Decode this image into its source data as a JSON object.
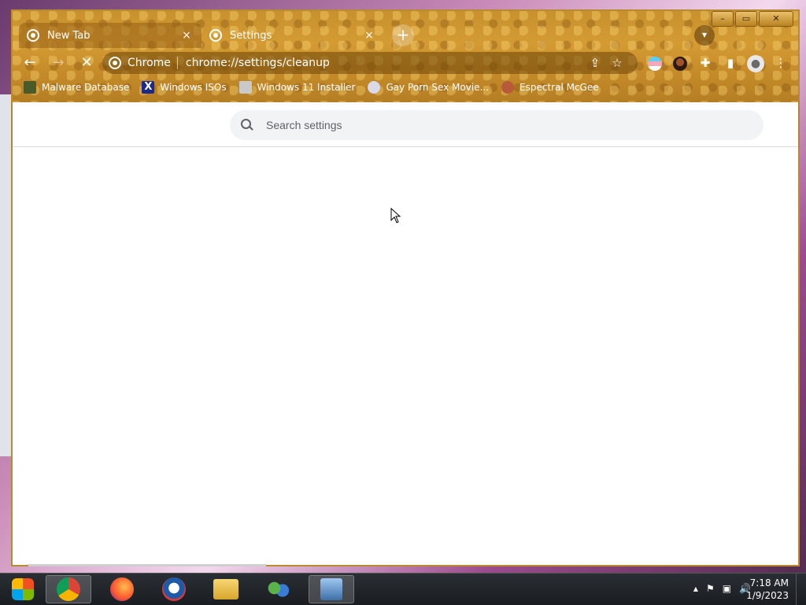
{
  "tabs": [
    {
      "title": "New Tab",
      "close": "×",
      "active": true
    },
    {
      "title": "Settings",
      "close": "×",
      "active": false
    }
  ],
  "new_tab_label": "+",
  "window_controls": {
    "minimize": "–",
    "maximize": "▭",
    "close": "✕"
  },
  "toolbar": {
    "back": "←",
    "forward": "→",
    "stop": "✕",
    "origin": "Chrome",
    "url": "chrome://settings/cleanup"
  },
  "bookmarks": [
    {
      "label": "Malware Database",
      "icon": "malware-db-icon",
      "color": "#4b5a2a"
    },
    {
      "label": "Windows ISOs",
      "icon": "x-icon",
      "color": "#1a2a8a"
    },
    {
      "label": "Windows 11 Installer",
      "icon": "installer-icon",
      "color": "#c9c9c9"
    },
    {
      "label": "Gay Porn Sex Movie...",
      "icon": "site-icon",
      "color": "#d9d9e8"
    },
    {
      "label": "Espectral McGee",
      "icon": "face-icon",
      "color": "#b85a3a"
    }
  ],
  "search": {
    "placeholder": "Search settings"
  },
  "clock": {
    "time": "7:18 AM",
    "date": "1/9/2023"
  },
  "colors": {
    "frame": "#c8912d",
    "accent": "#1a73e8"
  }
}
